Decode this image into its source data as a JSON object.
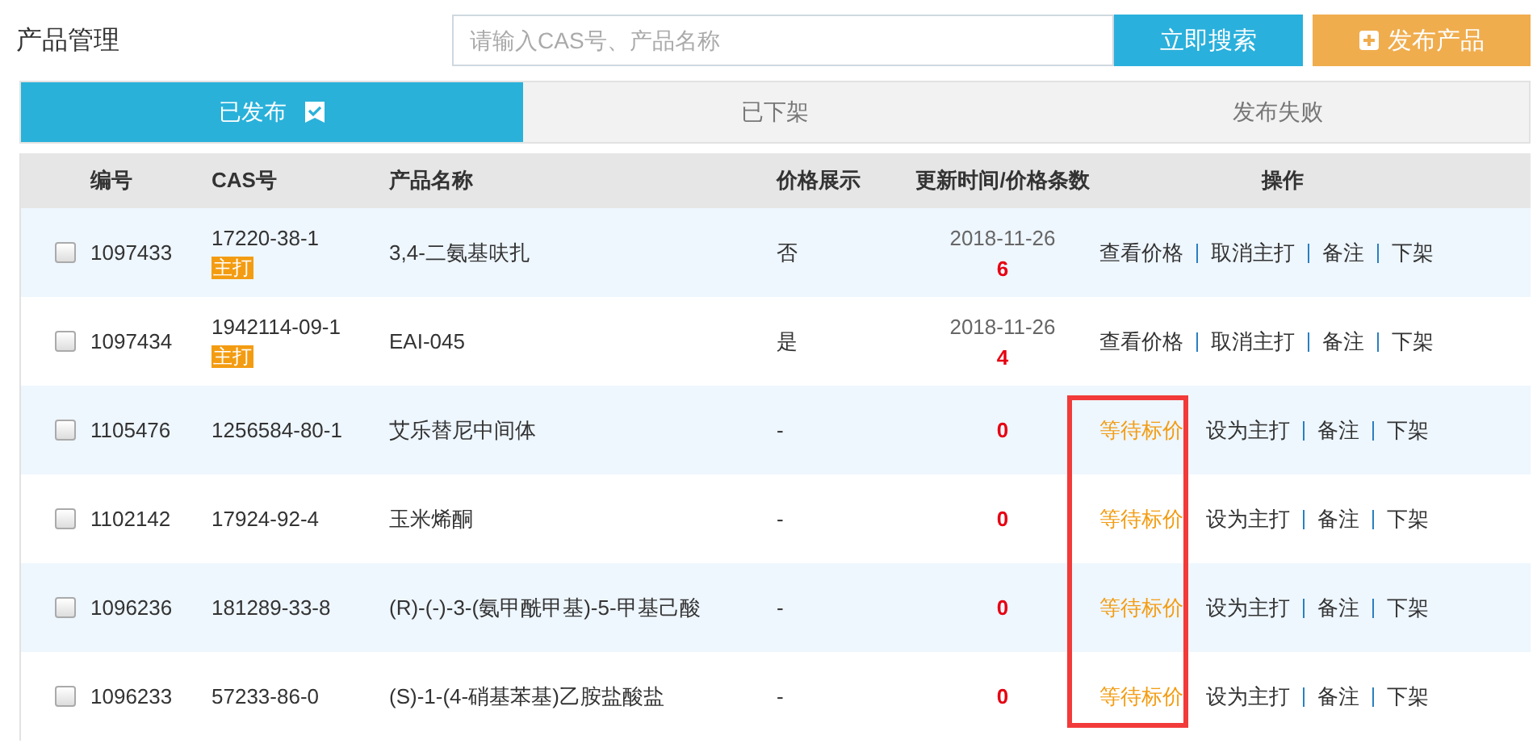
{
  "page_title": "产品管理",
  "search": {
    "placeholder": "请输入CAS号、产品名称",
    "button": "立即搜索"
  },
  "publish_button": "发布产品",
  "tabs": [
    {
      "label": "已发布",
      "selected": true
    },
    {
      "label": "已下架",
      "selected": false
    },
    {
      "label": "发布失败",
      "selected": false
    }
  ],
  "table": {
    "columns": [
      "编号",
      "CAS号",
      "产品名称",
      "价格展示",
      "更新时间/价格条数",
      "操作"
    ],
    "rows": [
      {
        "kind": "priced",
        "checked": false,
        "id": "1097433",
        "cas": "17220-38-1",
        "tag": "主打",
        "name": "3,4-二氨基呋扎",
        "price_display": "否",
        "date": "2018-11-26",
        "count": "6",
        "actions": [
          "查看价格",
          "取消主打",
          "备注",
          "下架"
        ]
      },
      {
        "kind": "priced",
        "checked": false,
        "id": "1097434",
        "cas": "1942114-09-1",
        "tag": "主打",
        "name": "EAI-045",
        "price_display": "是",
        "date": "2018-11-26",
        "count": "4",
        "actions": [
          "查看价格",
          "取消主打",
          "备注",
          "下架"
        ]
      },
      {
        "kind": "pending",
        "checked": false,
        "id": "1105476",
        "cas": "1256584-80-1",
        "name": "艾乐替尼中间体",
        "price_display": "-",
        "count": "0",
        "status": "等待标价",
        "actions": [
          "设为主打",
          "备注",
          "下架"
        ]
      },
      {
        "kind": "pending",
        "checked": false,
        "id": "1102142",
        "cas": "17924-92-4",
        "name": "玉米烯酮",
        "price_display": "-",
        "count": "0",
        "status": "等待标价",
        "actions": [
          "设为主打",
          "备注",
          "下架"
        ]
      },
      {
        "kind": "pending",
        "checked": false,
        "id": "1096236",
        "cas": "181289-33-8",
        "name": "(R)-(-)-3-(氨甲酰甲基)-5-甲基己酸",
        "price_display": "-",
        "count": "0",
        "status": "等待标价",
        "actions": [
          "设为主打",
          "备注",
          "下架"
        ]
      },
      {
        "kind": "pending",
        "checked": false,
        "id": "1096233",
        "cas": "57233-86-0",
        "name": "(S)-1-(4-硝基苯基)乙胺盐酸盐",
        "price_display": "-",
        "count": "0",
        "status": "等待标价",
        "actions": [
          "设为主打",
          "备注",
          "下架"
        ]
      }
    ]
  }
}
